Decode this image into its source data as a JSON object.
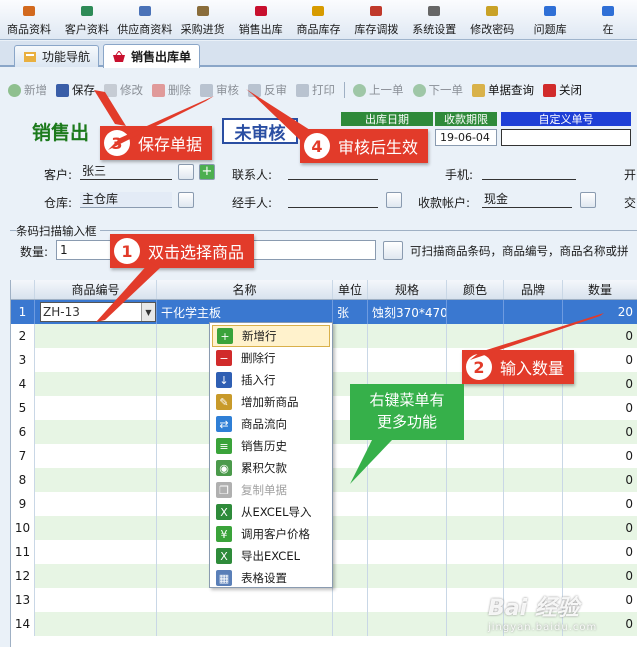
{
  "menu": [
    {
      "label": "商品资料",
      "icon": "boxes-icon",
      "color": "#d2691e"
    },
    {
      "label": "客户资料",
      "icon": "people-icon",
      "color": "#2e8b57"
    },
    {
      "label": "供应商资料",
      "icon": "supplier-icon",
      "color": "#4a72b8"
    },
    {
      "label": "采购进货",
      "icon": "truck-icon",
      "color": "#8a6d3b"
    },
    {
      "label": "销售出库",
      "icon": "basket-icon",
      "color": "#c8102e"
    },
    {
      "label": "商品库存",
      "icon": "stock-icon",
      "color": "#d79b00"
    },
    {
      "label": "库存调拨",
      "icon": "transfer-icon",
      "color": "#c0392b"
    },
    {
      "label": "系统设置",
      "icon": "gear-icon",
      "color": "#666666"
    },
    {
      "label": "修改密码",
      "icon": "key-icon",
      "color": "#c9a227"
    },
    {
      "label": "问题库",
      "icon": "question-icon",
      "color": "#2f6fd6"
    },
    {
      "label": "在",
      "icon": "online-icon",
      "color": "#2f6fd6"
    }
  ],
  "tabs": [
    {
      "label": "功能导航",
      "icon": "nav-icon"
    },
    {
      "label": "销售出库单",
      "icon": "basket-icon"
    }
  ],
  "toolbar": {
    "new": "新增",
    "save": "保存",
    "edit": "修改",
    "delete": "删除",
    "audit": "审核",
    "unaudit": "反审",
    "print": "打印",
    "prev": "上一单",
    "next": "下一单",
    "query": "单据查询",
    "close": "关闭"
  },
  "header": {
    "title": "销售出",
    "status": "未审核",
    "col_ship_date": "出库日期",
    "col_payment_term": "收款期限",
    "col_custom_no": "自定义单号",
    "date_value": "19-06-04"
  },
  "form": {
    "customer_label": "客户:",
    "customer_value": "张三",
    "contact_label": "联系人:",
    "phone_label": "手机:",
    "open_label": "开",
    "warehouse_label": "仓库:",
    "warehouse_value": "主仓库",
    "handler_label": "经手人:",
    "account_label": "收款帐户:",
    "account_value": "现金",
    "cross_label": "交"
  },
  "scan": {
    "legend": "条码扫描输入框",
    "qty_label": "数量:",
    "qty_value": "1",
    "hint": "可扫描商品条码，商品编号，商品名称或拼"
  },
  "grid": {
    "headers": [
      "商品编号",
      "名称",
      "单位",
      "规格",
      "颜色",
      "品牌",
      "数量"
    ],
    "rows": [
      {
        "no": "1",
        "code": "ZH-13",
        "name": "干化学主板",
        "unit": "张",
        "spec": "蚀刻370*470",
        "color": "",
        "brand": "",
        "qty": "20"
      },
      {
        "no": "2",
        "qty": "0"
      },
      {
        "no": "3",
        "qty": "0"
      },
      {
        "no": "4",
        "qty": "0"
      },
      {
        "no": "5",
        "qty": "0"
      },
      {
        "no": "6",
        "qty": "0"
      },
      {
        "no": "7",
        "qty": "0"
      },
      {
        "no": "8",
        "qty": "0"
      },
      {
        "no": "9",
        "qty": "0"
      },
      {
        "no": "10",
        "qty": "0"
      },
      {
        "no": "11",
        "qty": "0"
      },
      {
        "no": "12",
        "qty": "0"
      },
      {
        "no": "13",
        "qty": "0"
      },
      {
        "no": "14",
        "qty": "0"
      }
    ]
  },
  "context_menu": [
    {
      "label": "新增行",
      "icon": "add-row-icon",
      "color": "#3aa33a",
      "glyph": "+",
      "highlight": true
    },
    {
      "label": "删除行",
      "icon": "delete-row-icon",
      "color": "#d12b2b",
      "glyph": "−"
    },
    {
      "label": "插入行",
      "icon": "insert-row-icon",
      "color": "#2f5fb3",
      "glyph": "↓"
    },
    {
      "label": "增加新商品",
      "icon": "new-product-icon",
      "color": "#c89a2a",
      "glyph": "✎"
    },
    {
      "label": "商品流向",
      "icon": "flow-icon",
      "color": "#2f7fd6",
      "glyph": "⇄"
    },
    {
      "label": "销售历史",
      "icon": "history-icon",
      "color": "#3aa33a",
      "glyph": "≡"
    },
    {
      "label": "累积欠款",
      "icon": "debt-icon",
      "color": "#4b9a4b",
      "glyph": "◉"
    },
    {
      "label": "复制单据",
      "icon": "copy-icon",
      "color": "#b0b0b0",
      "glyph": "❐",
      "disabled": true
    },
    {
      "label": "从EXCEL导入",
      "icon": "excel-import-icon",
      "color": "#2e8b3a",
      "glyph": "X"
    },
    {
      "label": "调用客户价格",
      "icon": "price-icon",
      "color": "#3aa33a",
      "glyph": "¥"
    },
    {
      "label": "导出EXCEL",
      "icon": "excel-export-icon",
      "color": "#2e8b3a",
      "glyph": "X"
    },
    {
      "label": "表格设置",
      "icon": "table-settings-icon",
      "color": "#5a7fb8",
      "glyph": "▦"
    }
  ],
  "annotations": {
    "c1_num": "1",
    "c1_text": "双击选择商品",
    "c2_num": "2",
    "c2_text": "输入数量",
    "c3_num": "3",
    "c3_text": "保存单据",
    "c4_num": "4",
    "c4_text": "审核后生效",
    "bubble_line1": "右键菜单有",
    "bubble_line2": "更多功能"
  },
  "watermark": {
    "brand": "Bai 经验",
    "url": "jingyan.baidu.com"
  },
  "colors": {
    "accent_red": "#e23b2a",
    "bubble_green": "#36b04a",
    "selected_row": "#3a78d0",
    "title_green": "#1c7a1c"
  }
}
